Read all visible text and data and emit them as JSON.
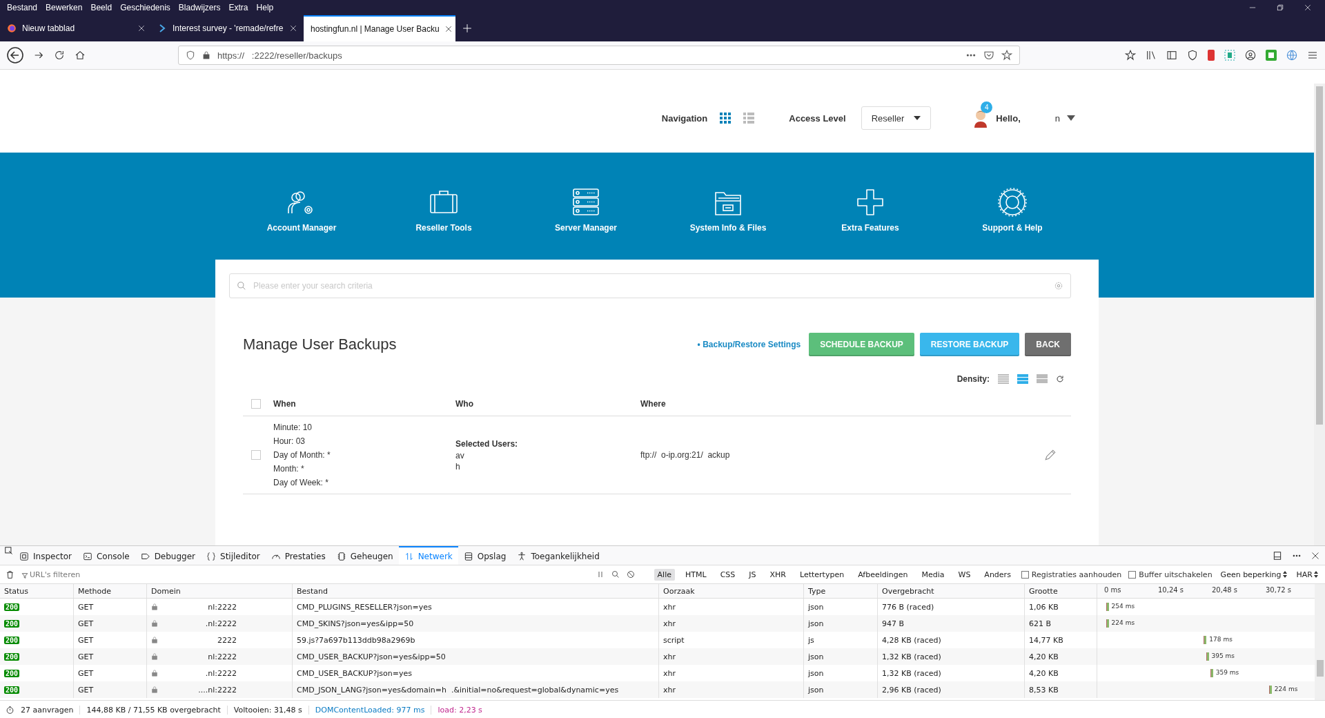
{
  "menubar": [
    "Bestand",
    "Bewerken",
    "Beeld",
    "Geschiedenis",
    "Bladwijzers",
    "Extra",
    "Help"
  ],
  "browser_tabs": [
    {
      "kind": "firefox",
      "title": "Nieuw tabblad",
      "selected": false
    },
    {
      "kind": "survey",
      "title": "Interest survey - 'remade/refre",
      "selected": false
    },
    {
      "kind": "none",
      "title": "hostingfun.nl | Manage User Backu",
      "selected": true
    }
  ],
  "address_bar": {
    "url": "https://   :2222/reseller/backups"
  },
  "header": {
    "navigation_label": "Navigation",
    "view_modes": [
      {
        "kind": "grid",
        "selected": true
      },
      {
        "kind": "list",
        "selected": false
      }
    ],
    "access_level_label": "Access Level",
    "access_level": "Reseller",
    "notification_count": "4",
    "greeting": "Hello,",
    "user_name": "n"
  },
  "nav_items": [
    {
      "kind": "account",
      "label": "Account Manager"
    },
    {
      "kind": "tools",
      "label": "Reseller Tools"
    },
    {
      "kind": "server",
      "label": "Server Manager"
    },
    {
      "kind": "files",
      "label": "System Info & Files"
    },
    {
      "kind": "extra",
      "label": "Extra Features"
    },
    {
      "kind": "support",
      "label": "Support & Help"
    }
  ],
  "search": {
    "placeholder": "Please enter your search criteria"
  },
  "page_title": "Manage User Backups",
  "settings_link": "• Backup/Restore Settings",
  "buttons": [
    {
      "kind": "schedule",
      "label": "SCHEDULE BACKUP"
    },
    {
      "kind": "restore",
      "label": "RESTORE BACKUP"
    },
    {
      "kind": "back",
      "label": "BACK"
    }
  ],
  "density": {
    "label": "Density:",
    "options": [
      {
        "selected": false
      },
      {
        "selected": true
      },
      {
        "selected": false
      }
    ]
  },
  "table": {
    "select_all_checked": false,
    "columns": [
      "When",
      "Who",
      "Where"
    ],
    "rows": [
      {
        "checked": false,
        "when": [
          "Minute: 10",
          "Hour: 03",
          "Day of Month: *",
          "Month: *",
          "Day of Week: *"
        ],
        "who_label": "Selected Users:",
        "who": [
          "av",
          "h"
        ],
        "where": "ftp://  o-ip.org:21/  ackup"
      }
    ]
  },
  "devtools": {
    "tabs": [
      {
        "kind": "inspector",
        "label": "Inspector",
        "selected": false
      },
      {
        "kind": "console",
        "label": "Console",
        "selected": false
      },
      {
        "kind": "debugger",
        "label": "Debugger",
        "selected": false
      },
      {
        "kind": "style",
        "label": "Stijleditor",
        "selected": false
      },
      {
        "kind": "perf",
        "label": "Prestaties",
        "selected": false
      },
      {
        "kind": "memory",
        "label": "Geheugen",
        "selected": false
      },
      {
        "kind": "network",
        "label": "Netwerk",
        "selected": true
      },
      {
        "kind": "storage",
        "label": "Opslag",
        "selected": false
      },
      {
        "kind": "access",
        "label": "Toegankelijkheid",
        "selected": false
      }
    ],
    "filter_placeholder": "URL's filteren",
    "type_filters": [
      {
        "label": "Alle",
        "selected": true
      },
      {
        "label": "HTML",
        "selected": false
      },
      {
        "label": "CSS",
        "selected": false
      },
      {
        "label": "JS",
        "selected": false
      },
      {
        "label": "XHR",
        "selected": false
      },
      {
        "label": "Lettertypen",
        "selected": false
      },
      {
        "label": "Afbeeldingen",
        "selected": false
      },
      {
        "label": "Media",
        "selected": false
      },
      {
        "label": "WS",
        "selected": false
      },
      {
        "label": "Anders",
        "selected": false
      }
    ],
    "options": [
      {
        "label": "Registraties aanhouden",
        "checked": false
      },
      {
        "label": "Buffer uitschakelen",
        "checked": false
      }
    ],
    "throttling": "Geen beperking",
    "har": "HAR",
    "columns": [
      "Status",
      "Methode",
      "Domein",
      "Bestand",
      "Oorzaak",
      "Type",
      "Overgebracht",
      "Grootte"
    ],
    "timeline_ticks": [
      "0 ms",
      "10,24 s",
      "20,48 s",
      "30,72 s"
    ],
    "requests": [
      {
        "status": "200",
        "method": "GET",
        "domain": "nl:2222",
        "file": "CMD_PLUGINS_RESELLER?json=yes",
        "cause": "xhr",
        "type": "json",
        "transferred": "776 B (raced)",
        "size": "1,06 KB",
        "duration": "254 ms"
      },
      {
        "status": "200",
        "method": "GET",
        "domain": ".nl:2222",
        "file": "CMD_SKINS?json=yes&ipp=50",
        "cause": "xhr",
        "type": "json",
        "transferred": "947 B",
        "size": "621 B",
        "duration": "224 ms"
      },
      {
        "status": "200",
        "method": "GET",
        "domain": "2222",
        "file": "59.js?7a697b113ddb98a2969b",
        "cause": "script",
        "type": "js",
        "transferred": "4,28 KB (raced)",
        "size": "14,77 KB",
        "duration": "178 ms"
      },
      {
        "status": "200",
        "method": "GET",
        "domain": "nl:2222",
        "file": "CMD_USER_BACKUP?json=yes&ipp=50",
        "cause": "xhr",
        "type": "json",
        "transferred": "1,32 KB (raced)",
        "size": "4,20 KB",
        "duration": "395 ms"
      },
      {
        "status": "200",
        "method": "GET",
        "domain": ".nl:2222",
        "file": "CMD_USER_BACKUP?json=yes",
        "cause": "xhr",
        "type": "json",
        "transferred": "1,32 KB (raced)",
        "size": "4,20 KB",
        "duration": "359 ms"
      },
      {
        "status": "200",
        "method": "GET",
        "domain": "....nl:2222",
        "file": "CMD_JSON_LANG?json=yes&domain=h  .&initial=no&request=global&dynamic=yes",
        "cause": "xhr",
        "type": "json",
        "transferred": "2,96 KB (raced)",
        "size": "8,53 KB",
        "duration": "224 ms"
      }
    ],
    "summary": {
      "requests": "27 aanvragen",
      "transferred": "144,88 KB / 71,55 KB overgebracht",
      "finished": "Voltooien: 31,48 s",
      "dom_loaded": "DOMContentLoaded: 977 ms",
      "load": "load: 2,23 s"
    }
  }
}
